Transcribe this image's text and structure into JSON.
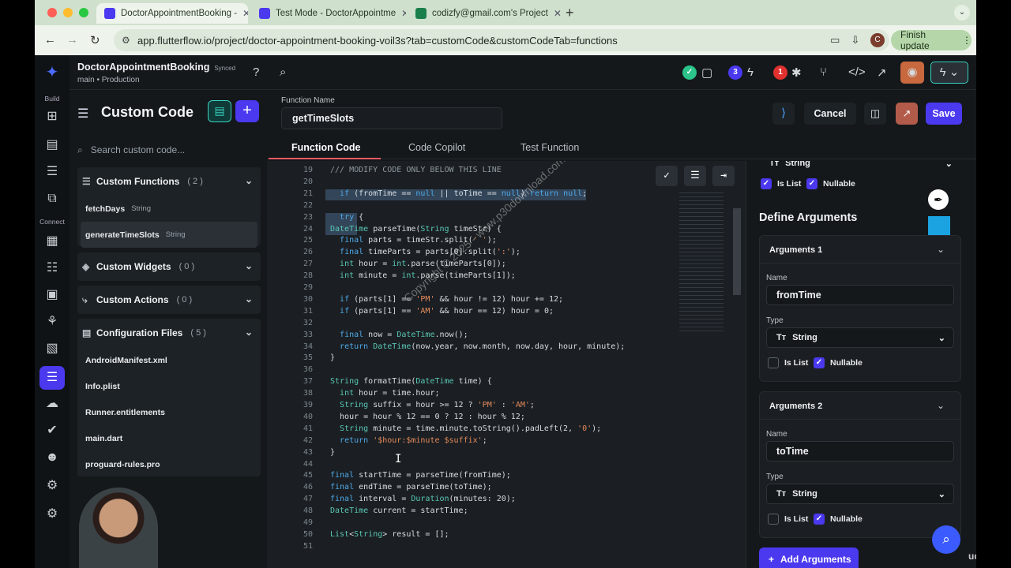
{
  "browser": {
    "tabs": [
      {
        "label": "DoctorAppointmentBooking -",
        "active": true
      },
      {
        "label": "Test Mode - DoctorAppointme",
        "active": false
      },
      {
        "label": "codizfy@gmail.com's Project",
        "active": false
      }
    ],
    "url": "app.flutterflow.io/project/doctor-appointment-booking-voil3s?tab=customCode&customCodeTab=functions",
    "profile_initial": "C",
    "finish_update": "Finish update"
  },
  "rail": {
    "build_label": "Build",
    "connect_label": "Connect"
  },
  "topbar": {
    "project_name": "DoctorAppointmentBooking",
    "synced": "Synced",
    "branch": "main • Production",
    "badge_blue": "3",
    "badge_red": "1"
  },
  "sidebar": {
    "title": "Custom Code",
    "search_placeholder": "Search custom code...",
    "groups": [
      {
        "name": "Custom Functions",
        "count": "( 2 )",
        "items": [
          {
            "name": "fetchDays",
            "type": "String"
          },
          {
            "name": "generateTimeSlots",
            "type": "String"
          }
        ]
      },
      {
        "name": "Custom Widgets",
        "count": "( 0 )",
        "items": []
      },
      {
        "name": "Custom Actions",
        "count": "( 0 )",
        "items": []
      },
      {
        "name": "Configuration Files",
        "count": "( 5 )",
        "items": [
          {
            "name": "AndroidManifest.xml"
          },
          {
            "name": "Info.plist"
          },
          {
            "name": "Runner.entitlements"
          },
          {
            "name": "main.dart"
          },
          {
            "name": "proguard-rules.pro"
          }
        ]
      }
    ]
  },
  "function": {
    "label": "Function Name",
    "name": "getTimeSlots",
    "cancel": "Cancel",
    "save": "Save"
  },
  "subtabs": [
    "Function Code",
    "Code Copilot",
    "Test Function"
  ],
  "code": [
    {
      "n": "19",
      "t": "/// MODIFY CODE ONLY BELOW THIS LINE"
    },
    {
      "n": "20",
      "t": ""
    },
    {
      "n": "21",
      "t": "  if (fromTime == null || toTime == null) return null;"
    },
    {
      "n": "22",
      "t": ""
    },
    {
      "n": "23",
      "t": "  try {"
    },
    {
      "n": "24",
      "t": "DateTime parseTime(String timeStr) {"
    },
    {
      "n": "25",
      "t": "  final parts = timeStr.split(' ');"
    },
    {
      "n": "26",
      "t": "  final timeParts = parts[0].split(':');"
    },
    {
      "n": "27",
      "t": "  int hour = int.parse(timeParts[0]);"
    },
    {
      "n": "28",
      "t": "  int minute = int.parse(timeParts[1]);"
    },
    {
      "n": "29",
      "t": ""
    },
    {
      "n": "30",
      "t": "  if (parts[1] == 'PM' && hour != 12) hour += 12;"
    },
    {
      "n": "31",
      "t": "  if (parts[1] == 'AM' && hour == 12) hour = 0;"
    },
    {
      "n": "32",
      "t": ""
    },
    {
      "n": "33",
      "t": "  final now = DateTime.now();"
    },
    {
      "n": "34",
      "t": "  return DateTime(now.year, now.month, now.day, hour, minute);"
    },
    {
      "n": "35",
      "t": "}"
    },
    {
      "n": "36",
      "t": ""
    },
    {
      "n": "37",
      "t": "String formatTime(DateTime time) {"
    },
    {
      "n": "38",
      "t": "  int hour = time.hour;"
    },
    {
      "n": "39",
      "t": "  String suffix = hour >= 12 ? 'PM' : 'AM';"
    },
    {
      "n": "40",
      "t": "  hour = hour % 12 == 0 ? 12 : hour % 12;"
    },
    {
      "n": "41",
      "t": "  String minute = time.minute.toString().padLeft(2, '0');"
    },
    {
      "n": "42",
      "t": "  return '$hour:$minute $suffix';"
    },
    {
      "n": "43",
      "t": "}"
    },
    {
      "n": "44",
      "t": ""
    },
    {
      "n": "45",
      "t": "final startTime = parseTime(fromTime);"
    },
    {
      "n": "46",
      "t": "final endTime = parseTime(toTime);"
    },
    {
      "n": "47",
      "t": "final interval = Duration(minutes: 20);"
    },
    {
      "n": "48",
      "t": "DateTime current = startTime;"
    },
    {
      "n": "49",
      "t": ""
    },
    {
      "n": "50",
      "t": "List<String> result = [];"
    },
    {
      "n": "51",
      "t": ""
    }
  ],
  "watermark": "Copyright © 2025 - www.p30download.com",
  "return_type": {
    "type": "String",
    "is_list": "Is List",
    "nullable": "Nullable"
  },
  "define_args_title": "Define Arguments",
  "arguments": [
    {
      "title": "Arguments 1",
      "name_label": "Name",
      "name": "fromTime",
      "type_label": "Type",
      "type": "String",
      "is_list": "Is List",
      "nullable": "Nullable"
    },
    {
      "title": "Arguments 2",
      "name_label": "Name",
      "name": "toTime",
      "type_label": "Type",
      "type": "String",
      "is_list": "Is List",
      "nullable": "Nullable"
    }
  ],
  "add_arguments": "Add Arguments",
  "udemy": "udemy",
  "colors": {
    "accent": "#4b39ef",
    "tab_underline": "#ff5963",
    "teal": "#39d2c0"
  }
}
